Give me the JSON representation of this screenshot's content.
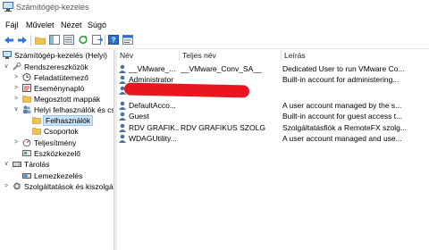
{
  "window": {
    "title": "Számítógép-kezelés"
  },
  "menu": [
    "Fájl",
    "Művelet",
    "Nézet",
    "Súgó"
  ],
  "toolbar": {
    "icons": [
      "back-arrow-icon",
      "forward-arrow-icon",
      "up-folder-icon",
      "show-tree-icon",
      "list-icon",
      "refresh-icon",
      "export-icon",
      "help-icon",
      "properties-icon"
    ]
  },
  "tree": {
    "items": [
      {
        "label": "Számítógép-kezelés (Helyi)",
        "expander": ""
      },
      {
        "label": "Rendszereszközök",
        "expander": "∨"
      },
      {
        "label": "Feladatütemező",
        "expander": ">"
      },
      {
        "label": "Eseménynapló",
        "expander": ">"
      },
      {
        "label": "Megosztott mappák",
        "expander": ">"
      },
      {
        "label": "Helyi felhasználók és cs",
        "expander": "∨"
      },
      {
        "label": "Felhasználók",
        "expander": ""
      },
      {
        "label": "Csoportok",
        "expander": ""
      },
      {
        "label": "Teljesítmény",
        "expander": ">"
      },
      {
        "label": "Eszközkezelő",
        "expander": ""
      },
      {
        "label": "Tárolás",
        "expander": "∨"
      },
      {
        "label": "Lemezkezelés",
        "expander": ""
      },
      {
        "label": "Szolgáltatások és kiszolgáló",
        "expander": ">"
      }
    ]
  },
  "list": {
    "columns": [
      "Név",
      "Teljes név",
      "Leírás"
    ],
    "rows": [
      {
        "name": "__VMware_...",
        "full": "__VMware_Conv_SA__",
        "desc": "Dedicated User to run VMware Co..."
      },
      {
        "name": "Administrator",
        "full": "",
        "desc": "Built-in account for administering..."
      },
      {
        "name": "",
        "full": "",
        "desc": ""
      },
      {
        "name": "DefaultAcco...",
        "full": "",
        "desc": "A user account managed by the s..."
      },
      {
        "name": "Guest",
        "full": "",
        "desc": "Built-in account for guest access t..."
      },
      {
        "name": "RDV GRAFIK...",
        "full": "RDV GRAFIKUS SZOLG",
        "desc": "Szolgáltatásfiók a RemoteFX szolg..."
      },
      {
        "name": "WDAGUtility...",
        "full": "",
        "desc": "A user account managed and use..."
      }
    ]
  },
  "colors": {
    "selection": "#cce4f7",
    "redaction": "#e8161f"
  }
}
